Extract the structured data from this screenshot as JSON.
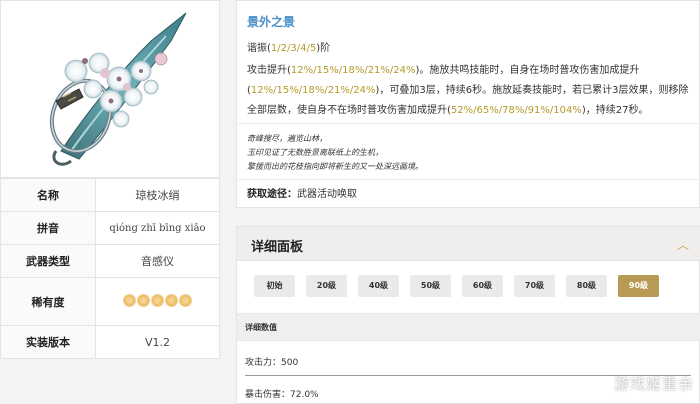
{
  "weapon_info": {
    "rows": [
      {
        "key": "名称",
        "value": "琼枝冰绡"
      },
      {
        "key": "拼音",
        "value": "qióng zhī bīng xiāo"
      },
      {
        "key": "武器类型",
        "value": "音感仪"
      },
      {
        "key": "稀有度",
        "value": "",
        "stars": 5
      },
      {
        "key": "实装版本",
        "value": "V1.2"
      }
    ]
  },
  "skill": {
    "title": "景外之景",
    "refine_prefix": "谐振(",
    "refine_levels": "1/2/3/4/5",
    "refine_suffix": ")阶",
    "effect_1": "攻击提升(",
    "effect_atk": "12%/15%/18%/21%/24%",
    "effect_2": ")。施放共鸣技能时，自身在场时普攻伤害加成提升",
    "effect_bonus": "12%/15%/18%/21%/24%",
    "effect_3": "，可叠加3层，持续6秒。施放延奏技能时，若已累计3层效果，则移除全部层数，使自身不在场时普攻伤害加成提升(",
    "effect_offfield": "52%/65%/78%/91%/104%",
    "effect_4": ")，持续27秒。",
    "quote_1": "奇峰搜尽，遍览山林，",
    "quote_2": "玉印见证了无数胜景离联纸上的生机，",
    "quote_3": "擎援而出的花枝指向即将新生的又一处深远画境。",
    "obtain_label": "获取途径：",
    "obtain_value": "武器活动唤取"
  },
  "panel": {
    "title": "详细面板",
    "levels": [
      "初始",
      "20级",
      "40级",
      "50级",
      "60级",
      "70级",
      "80级",
      "90级"
    ],
    "active_level": "90级",
    "detail_header": "详细数值",
    "stat_atk": "攻击力：500",
    "stat_crit": "暴击伤害：72.0%"
  },
  "watermark": "游戏姬重余",
  "colors": {
    "skill_title": "#4a8fc7",
    "highlight": "#b59a2a",
    "active_level": "#b99a55",
    "star": "#e8b45a"
  }
}
